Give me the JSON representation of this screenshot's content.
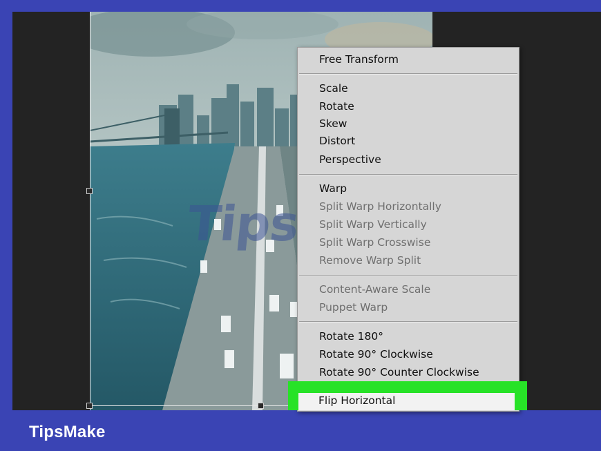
{
  "menu": {
    "items": [
      {
        "label": "Free Transform",
        "enabled": true
      },
      {
        "label": "Scale",
        "enabled": true
      },
      {
        "label": "Rotate",
        "enabled": true
      },
      {
        "label": "Skew",
        "enabled": true
      },
      {
        "label": "Distort",
        "enabled": true
      },
      {
        "label": "Perspective",
        "enabled": true
      },
      {
        "label": "Warp",
        "enabled": true
      },
      {
        "label": "Split Warp Horizontally",
        "enabled": false
      },
      {
        "label": "Split Warp Vertically",
        "enabled": false
      },
      {
        "label": "Split Warp Crosswise",
        "enabled": false
      },
      {
        "label": "Remove Warp Split",
        "enabled": false
      },
      {
        "label": "Content-Aware Scale",
        "enabled": false
      },
      {
        "label": "Puppet Warp",
        "enabled": false
      },
      {
        "label": "Rotate 180°",
        "enabled": true
      },
      {
        "label": "Rotate 90° Clockwise",
        "enabled": true
      },
      {
        "label": "Rotate 90° Counter Clockwise",
        "enabled": true
      },
      {
        "label": "Flip Horizontal",
        "enabled": true,
        "highlighted": true
      }
    ]
  },
  "watermark": "TipsMake",
  "brand": "TipsMake",
  "colors": {
    "frame": "#3a44b4",
    "highlight": "#27e227",
    "menu_bg": "#d6d6d6",
    "canvas_bg": "#232323"
  }
}
